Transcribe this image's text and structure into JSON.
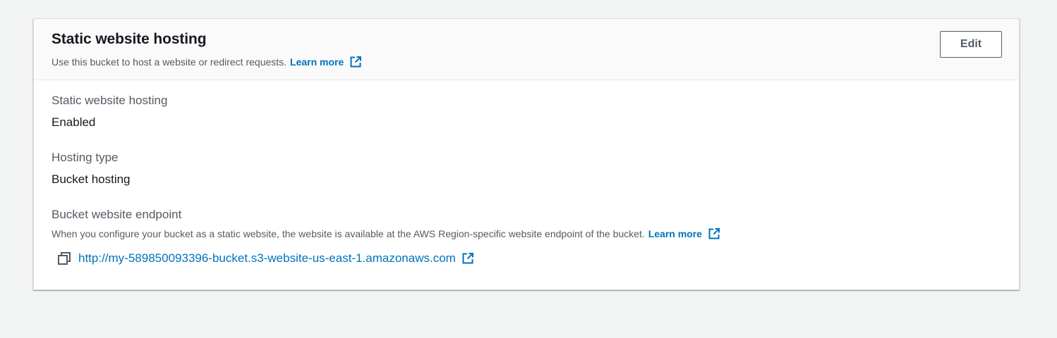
{
  "panel": {
    "title": "Static website hosting",
    "description": "Use this bucket to host a website or redirect requests.",
    "learn_more": "Learn more",
    "edit_label": "Edit"
  },
  "fields": {
    "hosting": {
      "label": "Static website hosting",
      "value": "Enabled"
    },
    "hosting_type": {
      "label": "Hosting type",
      "value": "Bucket hosting"
    },
    "endpoint": {
      "label": "Bucket website endpoint",
      "description": "When you configure your bucket as a static website, the website is available at the AWS Region-specific website endpoint of the bucket.",
      "learn_more": "Learn more",
      "url": "http://my-589850093396-bucket.s3-website-us-east-1.amazonaws.com"
    }
  },
  "icons": {
    "external_link": "external-link-icon",
    "copy": "copy-icon"
  },
  "colors": {
    "link": "#0073bb",
    "text": "#16191f",
    "secondary_text": "#545b64",
    "header_bg": "#fafafa",
    "page_bg": "#f2f3f3"
  }
}
